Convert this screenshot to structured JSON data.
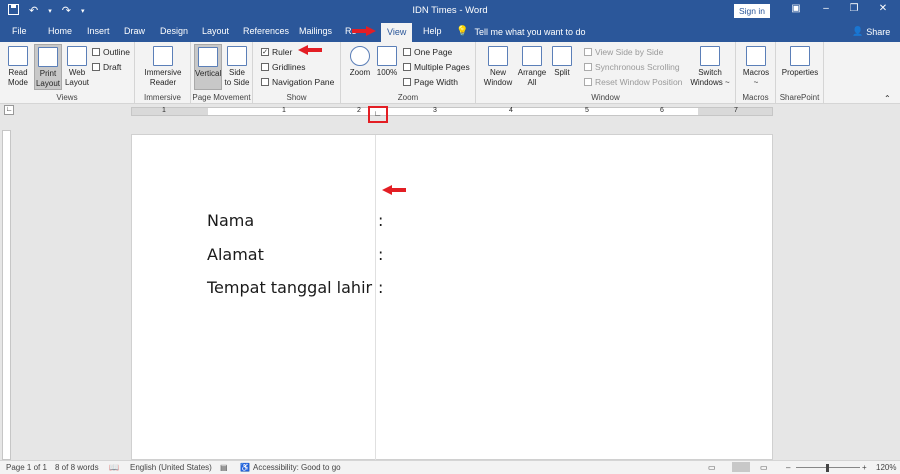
{
  "titlebar": {
    "title": "IDN Times  -  Word",
    "sign_in": "Sign in"
  },
  "tabs": [
    "File",
    "Home",
    "Insert",
    "Draw",
    "Design",
    "Layout",
    "References",
    "Mailings",
    "Re",
    "View",
    "Help"
  ],
  "active_tab": "View",
  "tell_me": "Tell me what you want to do",
  "share": "Share",
  "ribbon": {
    "views": {
      "label": "Views",
      "read_mode": "Read\nMode",
      "print_layout": "Print\nLayout",
      "web_layout": "Web\nLayout",
      "outline": "Outline",
      "draft": "Draft"
    },
    "immersive": {
      "label": "Immersive",
      "reader": "Immersive\nReader"
    },
    "page_movement": {
      "label": "Page Movement",
      "vertical": "Vertical",
      "side_to_side": "Side\nto Side"
    },
    "show": {
      "label": "Show",
      "ruler": "Ruler",
      "gridlines": "Gridlines",
      "navigation_pane": "Navigation Pane"
    },
    "zoom": {
      "label": "Zoom",
      "zoom": "Zoom",
      "hundred": "100%",
      "one_page": "One Page",
      "multiple_pages": "Multiple Pages",
      "page_width": "Page Width"
    },
    "window": {
      "label": "Window",
      "new_window": "New\nWindow",
      "arrange_all": "Arrange\nAll",
      "split": "Split",
      "view_side_by_side": "View Side by Side",
      "sync_scrolling": "Synchronous Scrolling",
      "reset_position": "Reset Window Position",
      "switch_windows": "Switch\nWindows ~"
    },
    "macros": {
      "label": "Macros",
      "macros": "Macros\n~"
    },
    "sharepoint": {
      "label": "SharePoint",
      "properties": "Properties"
    }
  },
  "ruler_numbers": [
    "1",
    "1",
    "2",
    "3",
    "4",
    "5",
    "6",
    "7"
  ],
  "document": {
    "lines": [
      {
        "label": "Nama",
        "colon": ":"
      },
      {
        "label": "Alamat",
        "colon": ":"
      },
      {
        "label": "Tempat tanggal lahir",
        "colon": ":"
      }
    ]
  },
  "status": {
    "page": "Page 1 of 1",
    "words": "8 of 8 words",
    "language": "English (United States)",
    "accessibility": "Accessibility: Good to go",
    "zoom": "120%"
  },
  "colors": {
    "brand": "#2b579a",
    "highlight": "#e31e24"
  }
}
